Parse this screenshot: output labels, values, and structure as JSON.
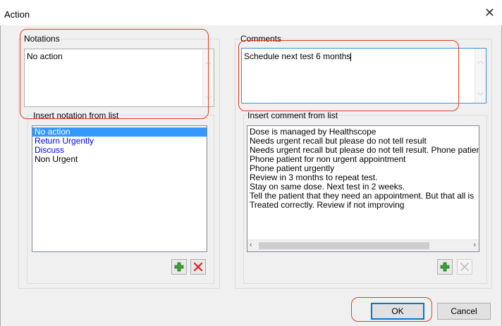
{
  "window": {
    "title": "Action",
    "close_glyph": "✕"
  },
  "notations": {
    "group_label": "Notations",
    "value": "No action",
    "list_label": "Insert notation from list",
    "items": [
      {
        "label": "No action",
        "state": "selected"
      },
      {
        "label": "Return Urgently",
        "color": "#0000ee"
      },
      {
        "label": "Discuss",
        "color": "#0000ee"
      },
      {
        "label": "Non Urgent",
        "color": "#000000"
      }
    ]
  },
  "comments": {
    "group_label": "Comments",
    "value": "Schedule next test 6 months",
    "list_label": "Insert comment from list",
    "items": [
      "Dose is managed by Healthscope",
      "Needs urgent recall but please do not tell result",
      "Needs urgent recall but please do not tell result. Phone patien",
      "Phone patient for non urgent appointment",
      "Phone patient urgently",
      "Review in 3 months to repeat test.",
      "Stay on same dose. Next test in 2 weeks.",
      "Tell the patient that they need an appointment.  But that all is",
      "Treated correctly. Review if not improving"
    ]
  },
  "buttons": {
    "ok": "OK",
    "cancel": "Cancel"
  },
  "icons": {
    "add": "plus-icon",
    "delete": "x-icon",
    "close": "close-icon"
  },
  "colors": {
    "highlight": "#e53b1e",
    "selection": "#3399ff",
    "link": "#0000ee"
  }
}
